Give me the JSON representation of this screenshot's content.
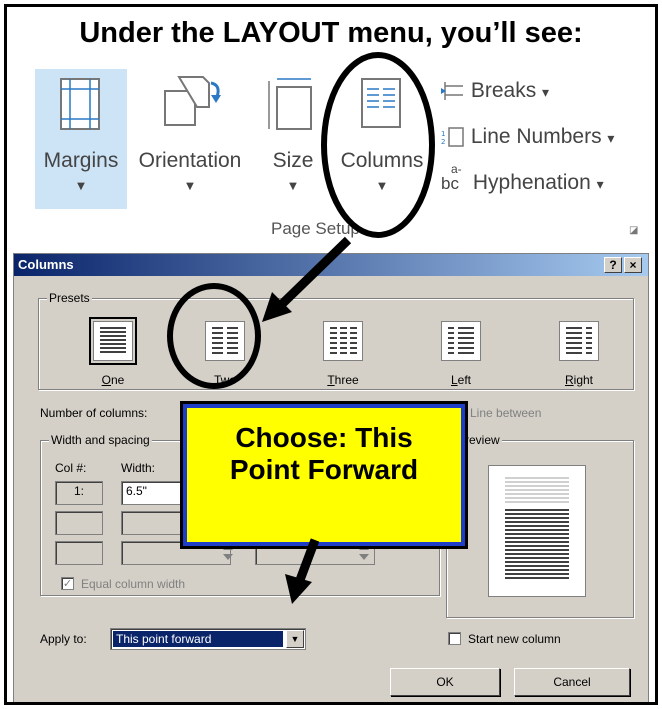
{
  "header": {
    "title": "Under the LAYOUT menu, you’ll see:"
  },
  "ribbon": {
    "margins_label": "Margins",
    "orientation_label": "Orientation",
    "size_label": "Size",
    "columns_label": "Columns",
    "breaks_label": "Breaks",
    "line_numbers_label": "Line Numbers",
    "hyphenation_label": "Hyphenation",
    "group_label": "Page Setup",
    "dropdown_glyph": "▼",
    "small_dropdown_glyph": "▾",
    "hyphenation_icon_text": "bc",
    "hyphenation_icon_sup": "a-",
    "launcher_glyph": "◪"
  },
  "dialog": {
    "title": "Columns",
    "help_glyph": "?",
    "close_glyph": "×",
    "presets_label": "Presets",
    "presets": [
      {
        "key": "one",
        "label": "One",
        "accel": "O",
        "rest": "ne"
      },
      {
        "key": "two",
        "label": "Two",
        "accel": "w",
        "pre": "T",
        "rest": "o"
      },
      {
        "key": "three",
        "label": "Three",
        "accel": "T",
        "rest": "hree"
      },
      {
        "key": "left",
        "label": "Left",
        "accel": "L",
        "rest": "eft"
      },
      {
        "key": "right",
        "label": "Right",
        "accel": "R",
        "rest": "ight"
      }
    ],
    "number_of_columns_label": "Number of columns:",
    "line_between_label": "Line between",
    "width_spacing_label": "Width and spacing",
    "col_header": "Col #:",
    "width_header": "Width:",
    "row1_col": "1:",
    "row1_width": "6.5\"",
    "preview_label": "Preview",
    "equal_width_label": "Equal column width",
    "apply_to_label": "Apply to:",
    "apply_to_value": "This point forward",
    "start_new_column_label": "Start new column",
    "ok_label": "OK",
    "cancel_label": "Cancel",
    "check_glyph": "✓",
    "spin_up": "▲",
    "spin_down": "▼"
  },
  "callout": {
    "line1": "Choose:  This",
    "line2": "Point Forward"
  },
  "colors": {
    "callout_fill": "#ffff00",
    "callout_border": "#1f3ec8",
    "ribbon_highlight": "#cde4f7",
    "dialog_bg": "#d4d0c8"
  }
}
